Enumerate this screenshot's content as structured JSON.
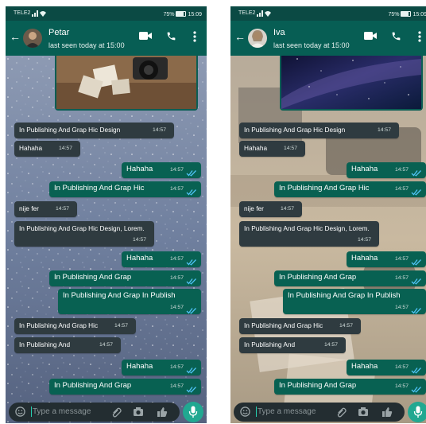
{
  "status_bar": {
    "carrier": "TELE2",
    "battery": "75%",
    "time": "15:09"
  },
  "left": {
    "contact_name": "Petar",
    "last_seen": "last seen today at 15:00",
    "messages": [
      {
        "dir": "in",
        "text": "In Publishing And Grap Hic Design",
        "time": "14:57"
      },
      {
        "dir": "in",
        "text": "Hahaha",
        "time": "14:57"
      },
      {
        "dir": "out",
        "text": "Hahaha",
        "time": "14:57"
      },
      {
        "dir": "out",
        "text": "In Publishing And Grap Hic",
        "time": "14:57"
      },
      {
        "dir": "in",
        "text": "nije fer",
        "time": "14:57"
      },
      {
        "dir": "in",
        "text": "In Publishing And Grap Hic Design, Lorem.",
        "time": "14:57"
      },
      {
        "dir": "out",
        "text": "Hahaha",
        "time": "14:57"
      },
      {
        "dir": "out",
        "text": "In Publishing And Grap",
        "time": "14:57"
      },
      {
        "dir": "out",
        "text": "In Publishing And Grap In Publish",
        "time": "14:57"
      },
      {
        "dir": "in",
        "text": "In Publishing And Grap Hic",
        "time": "14:57"
      },
      {
        "dir": "in",
        "text": "In Publishing And",
        "time": "14:57"
      },
      {
        "dir": "out",
        "text": "Hahaha",
        "time": "14:57"
      },
      {
        "dir": "out",
        "text": "In Publishing And Grap",
        "time": "14:57"
      }
    ]
  },
  "right": {
    "contact_name": "Iva",
    "last_seen": "last seen today at 15:00",
    "messages": [
      {
        "dir": "in",
        "text": "In Publishing And Grap Hic Design",
        "time": "14:57"
      },
      {
        "dir": "in",
        "text": "Hahaha",
        "time": "14:57"
      },
      {
        "dir": "out",
        "text": "Hahaha",
        "time": "14:57"
      },
      {
        "dir": "out",
        "text": "In Publishing And Grap Hic",
        "time": "14:57"
      },
      {
        "dir": "in",
        "text": "nije fer",
        "time": "14:57"
      },
      {
        "dir": "in",
        "text": "In Publishing And Grap Hic Design, Lorem.",
        "time": "14:57"
      },
      {
        "dir": "out",
        "text": "Hahaha",
        "time": "14:57"
      },
      {
        "dir": "out",
        "text": "In Publishing And Grap",
        "time": "14:57"
      },
      {
        "dir": "out",
        "text": "In Publishing And Grap In Publish",
        "time": "14:57"
      },
      {
        "dir": "in",
        "text": "In Publishing And Grap Hic",
        "time": "14:57"
      },
      {
        "dir": "in",
        "text": "In Publishing And",
        "time": "14:57"
      },
      {
        "dir": "out",
        "text": "Hahaha",
        "time": "14:57"
      },
      {
        "dir": "out",
        "text": "In Publishing And Grap",
        "time": "14:57"
      }
    ]
  },
  "input": {
    "placeholder": "Type a message"
  },
  "icons": {
    "back": "arrow-left-icon",
    "video": "video-camera-icon",
    "call": "phone-icon",
    "menu": "more-vertical-icon",
    "emoji": "emoji-icon",
    "attach": "paperclip-icon",
    "camera": "camera-icon",
    "like": "thumbs-up-icon",
    "mic": "microphone-icon",
    "read": "double-check-icon"
  },
  "colors": {
    "app_bar": "#075e54",
    "status_bar": "#0b4a44",
    "incoming_bubble": "#2f3b40",
    "outgoing_bubble": "#086152",
    "read_tick": "#4fc3f7",
    "input_bar": "#232d31",
    "mic_button": "#21a891"
  }
}
